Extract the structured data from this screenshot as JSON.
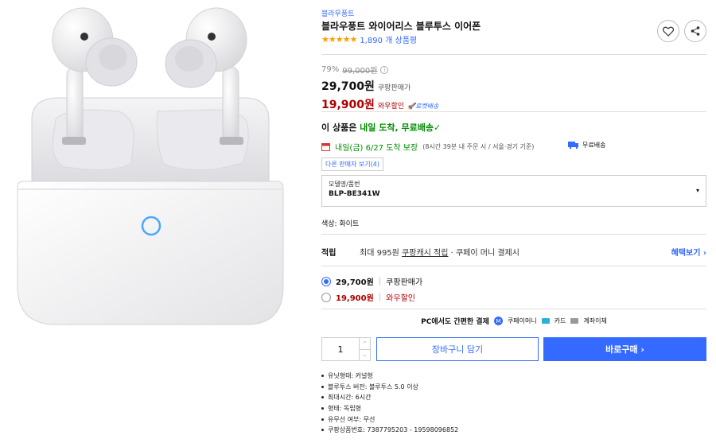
{
  "product": {
    "brand": "블라우풍트",
    "title": "블라우풍트 와이어리스 블루투스 이어폰",
    "stars": "★★★★★",
    "review_count": "1,890 개 상품평"
  },
  "price": {
    "discount_rate": "79%",
    "original_price": "99,000원",
    "sale_price": "29,700원",
    "sale_label": "쿠팡판매가",
    "member_price": "19,900원",
    "member_label": "와우할인",
    "rocket_label": "로켓배송"
  },
  "delivery": {
    "prefix": "이 상품은 ",
    "highlight": "내일 도착, 무료배송",
    "check": "✓",
    "arrival_main": "내일(금) 6/27 도착 보장",
    "arrival_detail": "(8시간 39분 내 주문 시 / 서울⋅경기 기준)",
    "free_shipping": "무료배송",
    "other_sellers": "다른 판매자 보기(4)"
  },
  "option": {
    "label": "모델명/품번",
    "value": "BLP-BE341W",
    "caret": "▾"
  },
  "color_line": "색상: 화이트",
  "reward": {
    "title": "적립",
    "prefix": "최대 995원 ",
    "link": "쿠팡캐시 적립",
    "suffix": " · 쿠페이 머니 결제시",
    "more": "혜택보기 ›"
  },
  "offers": [
    {
      "price": "29,700원",
      "label": "쿠팡판매가",
      "selected": true
    },
    {
      "price": "19,900원",
      "label": "와우할인",
      "selected": false
    }
  ],
  "payment": {
    "lead": "PC에서도 간편한 결제",
    "coupay": "쿠페이머니",
    "card": "카드",
    "bank": "계좌이체"
  },
  "purchase": {
    "quantity": "1",
    "cart_label": "장바구니 담기",
    "buy_label": "바로구매 ›"
  },
  "specs": [
    "유닛형태: 커널형",
    "블루투스 버전: 블루투스 5.0 이상",
    "최대시간: 6시간",
    "형태: 독립형",
    "유무선 여부: 무선",
    "쿠팡상품번호: 7387795203 - 19598096852"
  ],
  "colors": {
    "accent": "#346aff",
    "sale_red": "#ae0000",
    "delivery_green": "#008c00",
    "star": "#f6a000"
  },
  "icons": [
    "heart-icon",
    "share-icon",
    "info-icon",
    "calendar-icon",
    "truck-icon",
    "coupay-icon",
    "card-icon",
    "bank-icon"
  ]
}
